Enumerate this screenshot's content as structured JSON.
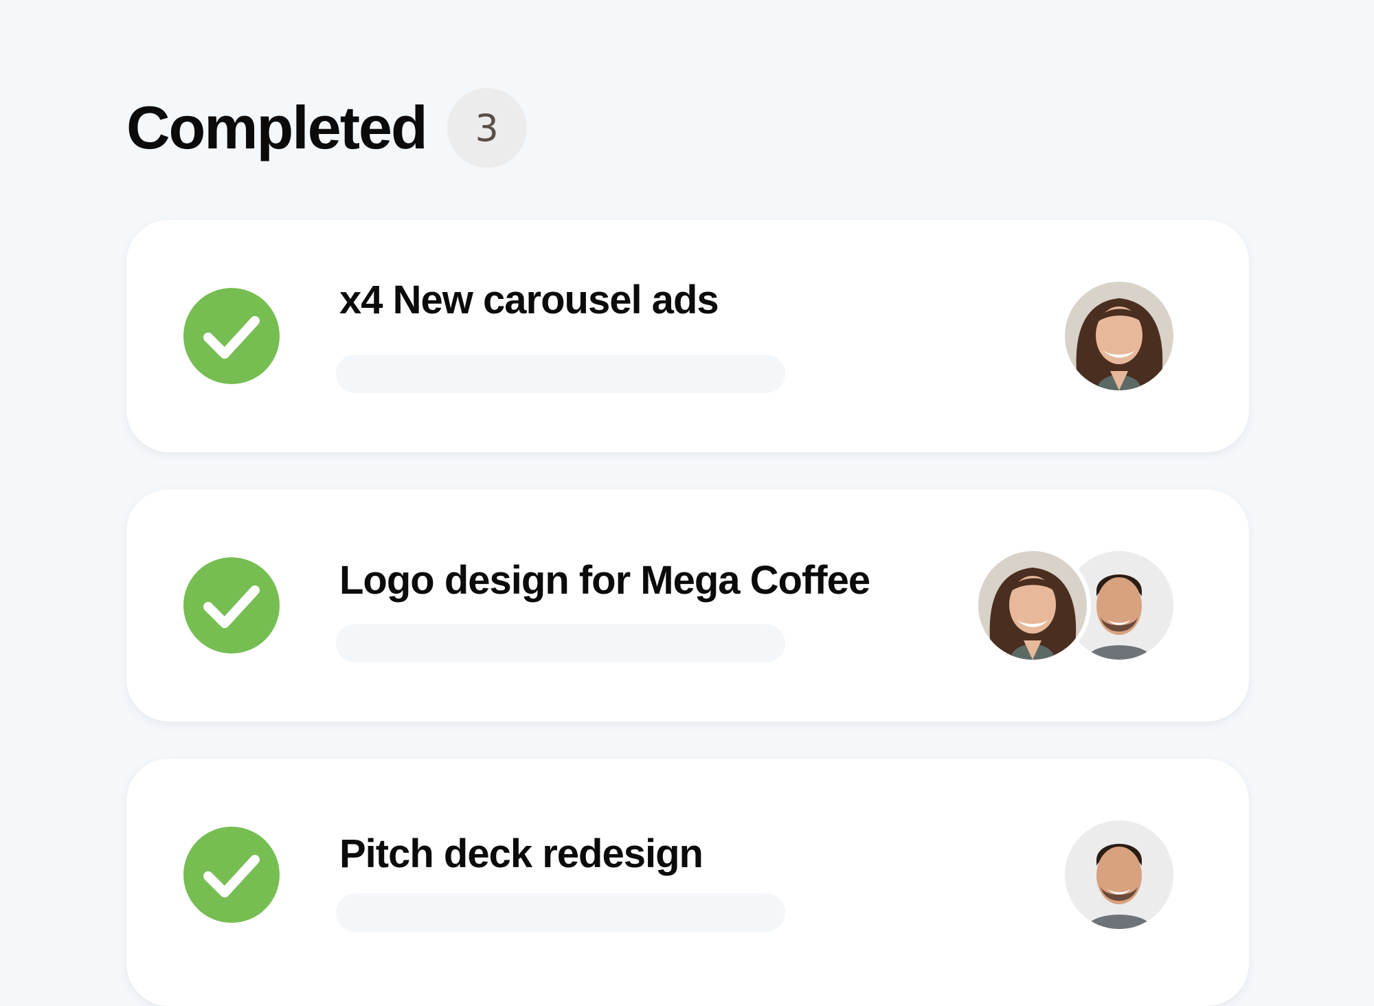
{
  "section": {
    "title": "Completed",
    "count": "3"
  },
  "colors": {
    "background": "#f5f8fb",
    "card": "#ffffff",
    "check": "#76bd52",
    "badge": "#ececec",
    "progress_track": "#f4f7fa"
  },
  "tasks": [
    {
      "title": "x4 New carousel ads",
      "status_icon": "check-circle-icon",
      "assignees": [
        "woman-avatar"
      ]
    },
    {
      "title": "Logo design for Mega Coffee",
      "status_icon": "check-circle-icon",
      "assignees": [
        "woman-avatar",
        "man-avatar"
      ]
    },
    {
      "title": "Pitch deck redesign",
      "status_icon": "check-circle-icon",
      "assignees": [
        "man-avatar"
      ]
    }
  ]
}
